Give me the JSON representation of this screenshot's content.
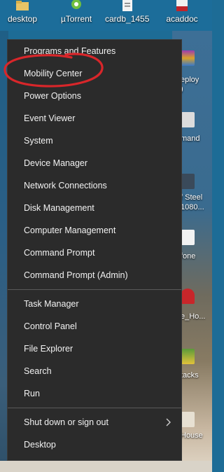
{
  "desktop": {
    "top_icons": [
      {
        "label": "desktop",
        "icon": "folder-icon"
      },
      {
        "label": "µTorrent",
        "icon": "utorrent-icon"
      },
      {
        "label": "cardb_1455...",
        "icon": "document-icon"
      },
      {
        "label": "acaddoc",
        "icon": "lsp-file-icon"
      }
    ],
    "side_fragments": [
      "eploy",
      ")",
      "mand",
      "f Steel",
      "1080...",
      "fone",
      "e_Ho...",
      "tacks",
      "House"
    ]
  },
  "menu": {
    "items": [
      "Programs and Features",
      "Mobility Center",
      "Power Options",
      "Event Viewer",
      "System",
      "Device Manager",
      "Network Connections",
      "Disk Management",
      "Computer Management",
      "Command Prompt",
      "Command Prompt (Admin)",
      "Task Manager",
      "Control Panel",
      "File Explorer",
      "Search",
      "Run",
      "Shut down or sign out",
      "Desktop"
    ]
  },
  "colors": {
    "menu_bg": "#2b2b2b",
    "menu_text": "#f2f2f2",
    "highlight_circle": "#d8262a"
  }
}
